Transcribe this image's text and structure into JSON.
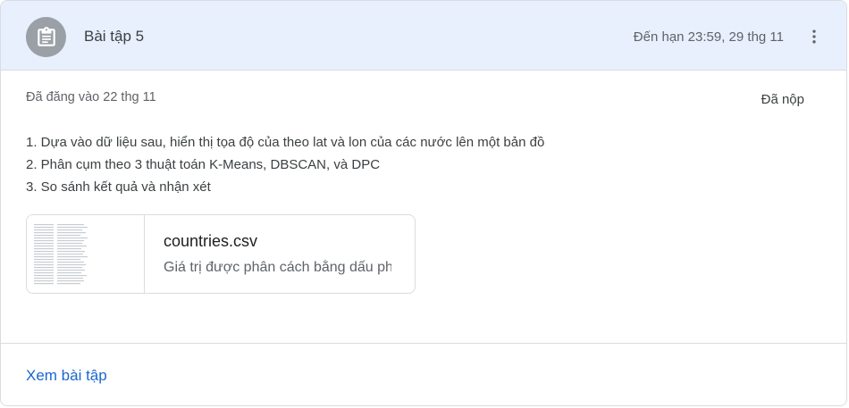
{
  "assignment": {
    "title": "Bài tập 5",
    "due": "Đến hạn 23:59, 29 thg 11",
    "posted": "Đã đăng vào 22 thg 11",
    "status": "Đã nộp",
    "icon": "assignment-icon"
  },
  "instructions": [
    "1. Dựa vào dữ liệu sau, hiển thị tọa độ của theo lat và lon của các nước lên một bản đồ",
    "2. Phân cụm theo 3 thuật toán K-Means, DBSCAN, và DPC",
    "3. So sánh kết quả và nhận xét"
  ],
  "attachment": {
    "name": "countries.csv",
    "type": "Giá trị được phân cách bằng dấu phẩy"
  },
  "footer": {
    "link_label": "Xem bài tập"
  },
  "colors": {
    "header_bg": "#e8f0fe",
    "avatar_bg": "#9aa0a6",
    "link": "#1967d2",
    "border": "#dadce0"
  }
}
